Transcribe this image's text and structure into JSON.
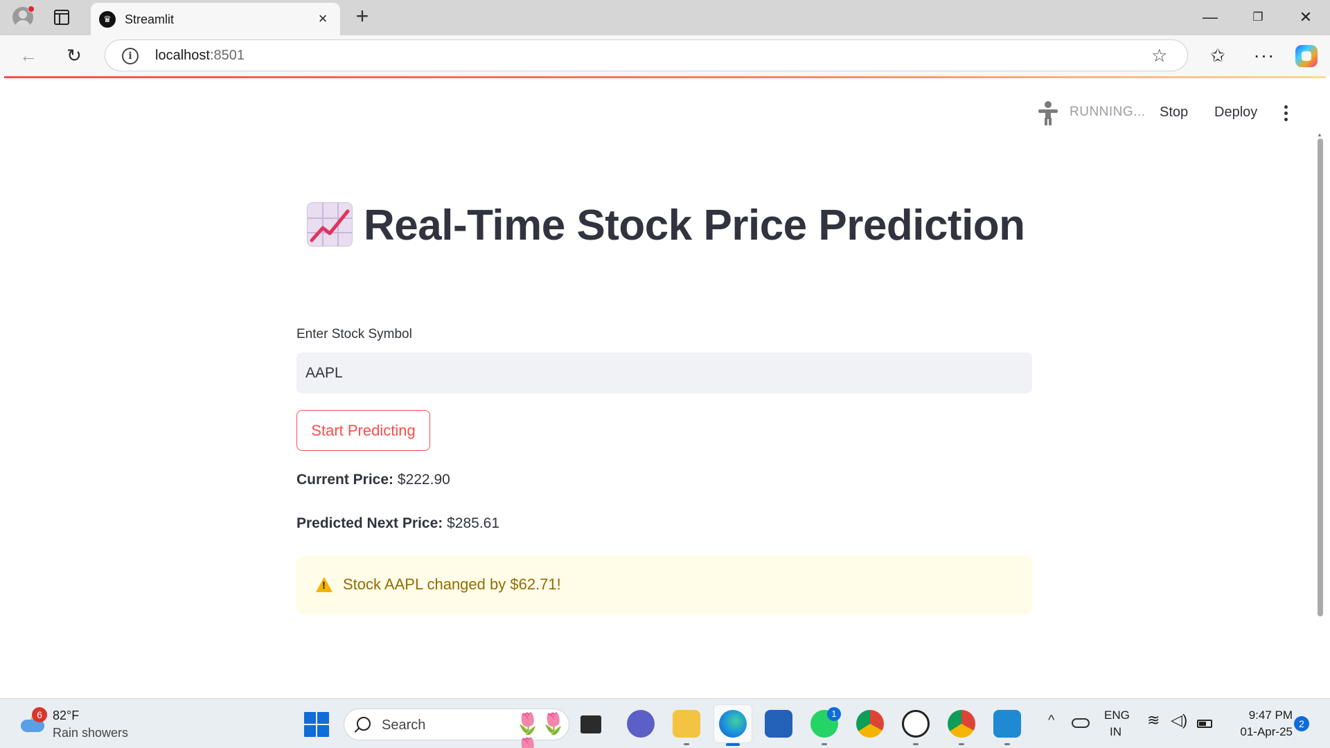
{
  "browser": {
    "tab_title": "Streamlit",
    "tab_favicon": "streamlit-crown-icon",
    "tab_close": "×",
    "new_tab": "+",
    "address_host": "localhost",
    "address_port": ":8501",
    "window_min": "—",
    "window_max": "❐",
    "window_close": "✕"
  },
  "header": {
    "status": "RUNNING...",
    "stop_label": "Stop",
    "deploy_label": "Deploy",
    "menu_icon": "vertical-ellipsis-icon",
    "status_icon": "running-person-icon"
  },
  "main": {
    "title_emoji": "chart-increasing-icon",
    "title": "Real-Time Stock Price Prediction",
    "input_label": "Enter Stock Symbol",
    "input_value": "AAPL",
    "button_label": "Start Predicting",
    "current_price_label": "Current Price:",
    "current_price_value": "$222.90",
    "predicted_price_label": "Predicted Next Price:",
    "predicted_price_value": "$285.61",
    "alert_text": "Stock AAPL changed by $62.71!"
  },
  "taskbar": {
    "weather_badge": "6",
    "weather_temp": "82°F",
    "weather_desc": "Rain showers",
    "search_label": "Search",
    "search_flowers": "🌷🌷🌷",
    "whatsapp_badge": "1",
    "lang_line1": "ENG",
    "lang_line2": "IN",
    "time": "9:47 PM",
    "date": "01-Apr-25",
    "notification_count": "2"
  },
  "colors": {
    "primary": "#ff4b4b",
    "text": "#31333f",
    "input_bg": "#f0f2f6",
    "warning_bg": "#fffce7",
    "warning_text": "#926c05",
    "taskbar_accent": "#0f6cd8"
  }
}
